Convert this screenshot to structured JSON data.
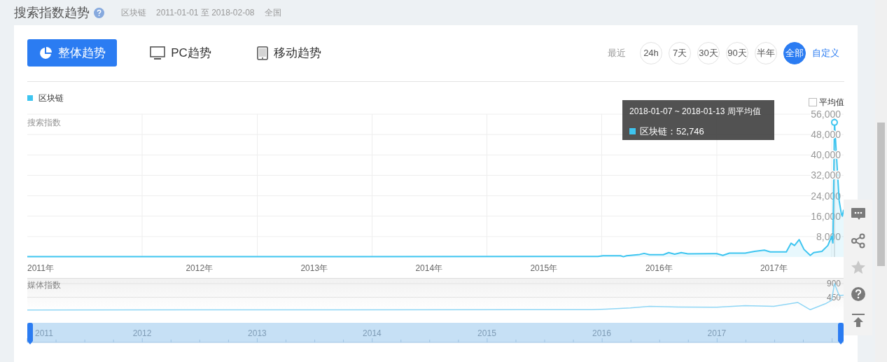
{
  "header": {
    "title": "搜索指数趋势",
    "keyword": "区块链",
    "date_range": "2011-01-01 至 2018-02-08",
    "region": "全国"
  },
  "tabs": [
    {
      "label": "整体趋势",
      "kind": "overall",
      "selected": true
    },
    {
      "label": "PC趋势",
      "kind": "pc",
      "selected": false
    },
    {
      "label": "移动趋势",
      "kind": "mobile",
      "selected": false
    }
  ],
  "range_label": "最近",
  "ranges": [
    {
      "label": "24h",
      "selected": false
    },
    {
      "label": "7天",
      "selected": false
    },
    {
      "label": "30天",
      "selected": false
    },
    {
      "label": "90天",
      "selected": false
    },
    {
      "label": "半年",
      "selected": false
    },
    {
      "label": "全部",
      "selected": true
    }
  ],
  "custom_link": "自定义",
  "average_toggle": {
    "label": "平均值",
    "checked": false
  },
  "search_chart": {
    "chart_data": {
      "type": "area",
      "grid": true,
      "ylabel": "搜索指数",
      "xlim": [
        "2011-01-01",
        "2018-02-08"
      ],
      "ylim": [
        0,
        56000
      ],
      "x": [
        "2011-01-01",
        "2015-12-20",
        "2016-01-05",
        "2016-03-01",
        "2016-03-10",
        "2016-03-20",
        "2016-05-01",
        "2016-05-15",
        "2016-06-01",
        "2016-07-15",
        "2016-08-01",
        "2016-08-20",
        "2016-09-10",
        "2016-10-01",
        "2017-01-01",
        "2017-01-20",
        "2017-02-10",
        "2017-04-01",
        "2017-05-01",
        "2017-06-01",
        "2017-06-20",
        "2017-08-10",
        "2017-08-25",
        "2017-09-05",
        "2017-09-20",
        "2017-10-05",
        "2017-10-25",
        "2017-11-05",
        "2017-12-01",
        "2017-12-20",
        "2018-01-01",
        "2018-01-05",
        "2018-01-10",
        "2018-01-25",
        "2018-02-01",
        "2018-02-04",
        "2018-02-08"
      ],
      "series": [
        {
          "name": "区块链",
          "color": "#3ec5f0",
          "values": [
            100,
            200,
            500,
            500,
            100,
            500,
            1000,
            1400,
            900,
            900,
            1700,
            1100,
            1700,
            1200,
            1300,
            600,
            1500,
            1500,
            2200,
            2700,
            2000,
            2000,
            5400,
            4500,
            6800,
            3000,
            600,
            1700,
            2200,
            4500,
            8100,
            5500,
            52746,
            22000,
            16800,
            16000,
            18500
          ]
        }
      ],
      "yticks": [
        {
          "value": 8000,
          "label": "8,000"
        },
        {
          "value": 16000,
          "label": "16,000"
        },
        {
          "value": 24000,
          "label": "24,000"
        },
        {
          "value": 32000,
          "label": "32,000"
        },
        {
          "value": 40000,
          "label": "40,000"
        },
        {
          "value": 48000,
          "label": "48,000"
        },
        {
          "value": 56000,
          "label": "56,000"
        }
      ],
      "xticks": [
        {
          "value": "2011-01-01",
          "label": "2011年"
        },
        {
          "value": "2012-07-01",
          "label": "2012年"
        },
        {
          "value": "2013-07-01",
          "label": "2013年"
        },
        {
          "value": "2014-07-01",
          "label": "2014年"
        },
        {
          "value": "2015-07-01",
          "label": "2015年"
        },
        {
          "value": "2016-07-01",
          "label": "2016年"
        },
        {
          "value": "2017-07-01",
          "label": "2017年"
        }
      ]
    },
    "tooltip": {
      "title": "2018-01-07 ~ 2018-01-13 周平均值",
      "items": [
        {
          "label": "区块链：",
          "value": "52,746",
          "color": "#3ec5f0"
        }
      ]
    }
  },
  "media_chart": {
    "chart_data": {
      "type": "line",
      "grid": true,
      "ylabel": "媒体指数",
      "xlim": [
        "2011-01-01",
        "2018-02-08"
      ],
      "ylim": [
        0,
        900
      ],
      "x": [
        "2011-01-01",
        "2015-12-01",
        "2016-01-15",
        "2016-04-01",
        "2016-06-01",
        "2016-09-01",
        "2017-01-01",
        "2017-04-01",
        "2017-07-01",
        "2017-09-15",
        "2017-10-25",
        "2017-12-15",
        "2018-01-01",
        "2018-01-10",
        "2018-01-25",
        "2018-02-08"
      ],
      "series": [
        {
          "color": "#8fd6f5",
          "values": [
            30,
            40,
            60,
            100,
            150,
            130,
            120,
            170,
            150,
            280,
            40,
            250,
            350,
            900,
            500,
            520
          ]
        }
      ],
      "yticks": [
        {
          "value": 450,
          "label": "450"
        },
        {
          "value": 900,
          "label": "900"
        }
      ]
    }
  },
  "navigator": {
    "labels": [
      "2011",
      "2012",
      "2013",
      "2014",
      "2015",
      "2016",
      "2017"
    ]
  },
  "side_tools": [
    {
      "kind": "comment"
    },
    {
      "kind": "share"
    },
    {
      "kind": "star"
    },
    {
      "kind": "help"
    },
    {
      "kind": "top"
    }
  ]
}
